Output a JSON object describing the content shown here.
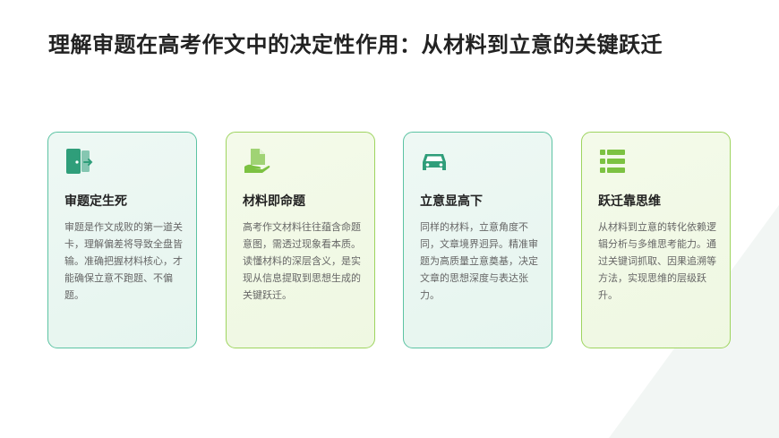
{
  "title": "理解审题在高考作文中的决定性作用：从材料到立意的关键跃迁",
  "cards": [
    {
      "icon": "door-exit-icon",
      "title": "审题定生死",
      "body": "审题是作文成败的第一道关卡，理解偏差将导致全盘皆输。准确把握材料核心，才能确保立意不跑题、不偏题。"
    },
    {
      "icon": "hand-document-icon",
      "title": "材料即命题",
      "body": "高考作文材料往往蕴含命题意图，需透过现象看本质。读懂材料的深层含义，是实现从信息提取到思想生成的关键跃迁。"
    },
    {
      "icon": "car-icon",
      "title": "立意显高下",
      "body": "同样的材料，立意角度不同，文章境界迥异。精准审题为高质量立意奠基，决定文章的思想深度与表达张力。"
    },
    {
      "icon": "list-layers-icon",
      "title": "跃迁靠思维",
      "body": "从材料到立意的转化依赖逻辑分析与多维思考能力。通过关键词抓取、因果追溯等方法，实现思维的层级跃升。"
    }
  ],
  "colors": {
    "teal": "#2f9e7a",
    "lime": "#7cc242",
    "title": "#222222",
    "body": "#666666"
  }
}
